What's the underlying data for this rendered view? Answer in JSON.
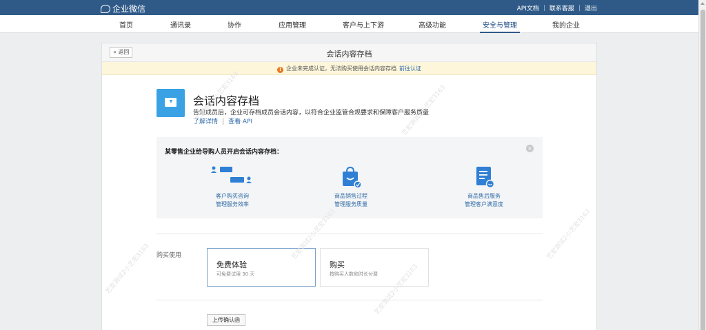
{
  "topbar": {
    "logo_text": "企业微信",
    "links": [
      "API文档",
      "联系客服",
      "退出"
    ],
    "separator": "|"
  },
  "nav": {
    "items": [
      {
        "label": "首页",
        "active": false
      },
      {
        "label": "通讯录",
        "active": false
      },
      {
        "label": "协作",
        "active": false
      },
      {
        "label": "应用管理",
        "active": false
      },
      {
        "label": "客户与上下游",
        "active": false
      },
      {
        "label": "高级功能",
        "active": false
      },
      {
        "label": "安全与管理",
        "active": true
      },
      {
        "label": "我的企业",
        "active": false
      }
    ]
  },
  "panel": {
    "back_label": "« 返回",
    "title": "会话内容存档"
  },
  "warning": {
    "icon": "!",
    "text": "企业未完成认证，无法购买使用会话内容存档",
    "link": "前往认证"
  },
  "feature": {
    "icon": "archive-download-icon",
    "title": "会话内容存档",
    "description": "告知成员后，企业可存档成员会话内容，以符合企业监管合规要求和保障客户服务质量",
    "link_details": "了解详情",
    "link_sep": "|",
    "link_api": "查看 API"
  },
  "case": {
    "title": "某零售企业给导购人员开启会话内容存档：",
    "close_icon": "×",
    "items": [
      {
        "icon": "chat-people-icon",
        "line1": "客户购买咨询",
        "line2": "管理服务效率"
      },
      {
        "icon": "shopping-bag-icon",
        "line1": "商品销售过程",
        "line2": "管理服务质量"
      },
      {
        "icon": "document-smile-icon",
        "line1": "商品售后服务",
        "line2": "管理客户满意度"
      }
    ]
  },
  "purchase": {
    "label": "购买使用",
    "options": [
      {
        "title": "免费体验",
        "subtitle": "可免费试用 30 天",
        "selected": true
      },
      {
        "title": "购买",
        "subtitle": "按购买人数和时长付费",
        "selected": false
      }
    ],
    "upload_label": "上传确认函"
  },
  "watermark": {
    "text": "艺宏测试2小艺宏3163"
  },
  "colors": {
    "topbar": "#2f5a88",
    "accent": "#3aa2e4",
    "link": "#2f6aa8",
    "warning_bg": "#fdf6db",
    "warning_icon": "#e8771e"
  }
}
